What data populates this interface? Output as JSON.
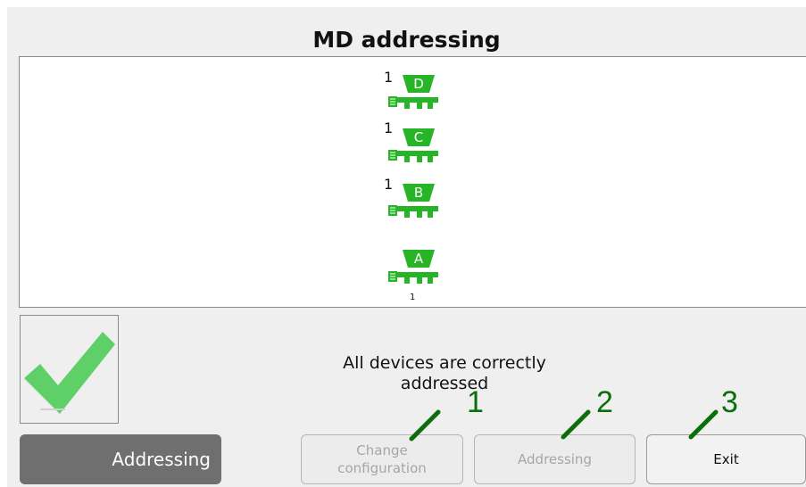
{
  "screen": {
    "title": "MD addressing"
  },
  "devices": [
    {
      "letter": "D",
      "count": "1"
    },
    {
      "letter": "C",
      "count": "1"
    },
    {
      "letter": "B",
      "count": "1"
    },
    {
      "letter": "A",
      "count": "1"
    }
  ],
  "status": {
    "icon": "checkmark-icon",
    "line1": "All devices are correctly",
    "line2": "addressed"
  },
  "footer": {
    "mode_label": "Addressing",
    "change_config_line1": "Change",
    "change_config_line2": "configuration",
    "addressing_label": "Addressing",
    "exit_label": "Exit"
  },
  "callouts": [
    "1",
    "2",
    "3"
  ],
  "colors": {
    "device_green": "#27b427",
    "check_green": "#5fd068",
    "callout_green": "#0a6e0a",
    "dark_button": "#6f6f6f"
  }
}
